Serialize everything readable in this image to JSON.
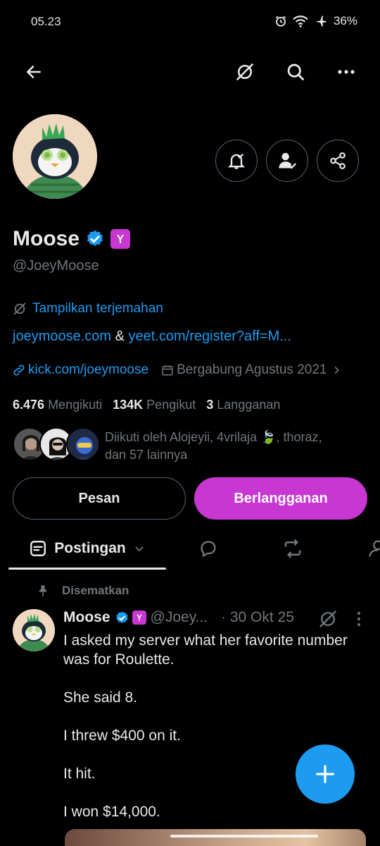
{
  "status": {
    "time": "05.23",
    "battery": "36%"
  },
  "profile": {
    "display_name": "Moose",
    "handle": "@JoeyMoose",
    "translate_label": "Tampilkan terjemahan",
    "bio_link1": "joeymoose.com",
    "bio_amp": " & ",
    "bio_link2": "yeet.com/register?aff=M...",
    "website": "kick.com/joeymoose",
    "joined": "Bergabung Agustus 2021",
    "following_count": "6.476",
    "following_label": "Mengikuti",
    "followers_count": "134K",
    "followers_label": "Pengikut",
    "subs_count": "3",
    "subs_label": "Langganan",
    "followed_by_prefix": "Diikuti oleh Alojeyii, 4vrilaja ",
    "followed_by_emoji": "🍃",
    "followed_by_suffix": ", thoraz,",
    "followed_by_line2": "dan 57 lainnya"
  },
  "actions": {
    "message": "Pesan",
    "subscribe": "Berlangganan"
  },
  "tabs": {
    "posts": "Postingan"
  },
  "post": {
    "pinned_label": "Disematkan",
    "author": "Moose",
    "handle": "@Joey...",
    "date": "· 30 Okt 25",
    "lines": [
      "I asked my server what her favorite number was for Roulette.",
      "She said 8.",
      "I threw $400 on it.",
      "It hit.",
      "I won $14,000."
    ]
  },
  "colors": {
    "accent": "#1d9bf0",
    "subscribe": "#c837d1",
    "background": "#000000",
    "muted": "#71767b"
  },
  "icons": [
    "back-arrow-icon",
    "grok-icon",
    "search-icon",
    "more-icon",
    "bell-check-icon",
    "person-check-icon",
    "share-icon",
    "verified-badge-icon",
    "subscriber-badge-icon",
    "translate-icon",
    "link-icon",
    "calendar-icon",
    "chevron-right-icon",
    "list-icon",
    "chevron-down-icon",
    "reply-icon",
    "repost-icon",
    "pin-icon",
    "plus-icon"
  ]
}
